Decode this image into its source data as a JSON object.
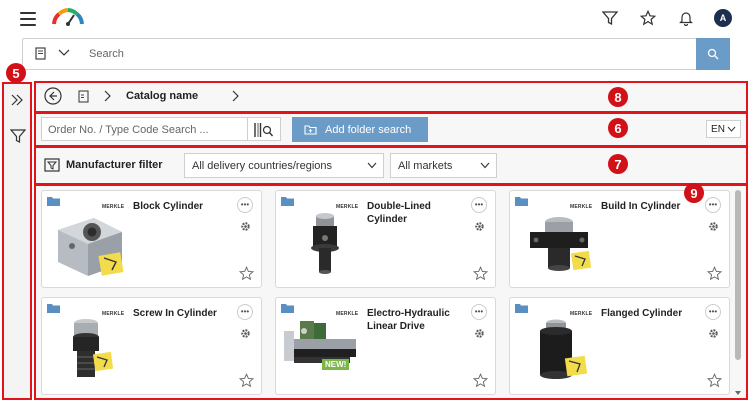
{
  "header": {
    "icons": [
      "menu-icon",
      "logo",
      "filter-icon",
      "star-icon",
      "bell-icon"
    ],
    "avatar_initial": "A"
  },
  "search": {
    "placeholder": "Search"
  },
  "breadcrumb": {
    "title": "Catalog name"
  },
  "order_search": {
    "placeholder": "Order No. / Type Code Search ...",
    "add_folder_label": "Add folder search",
    "language": "EN"
  },
  "filters": {
    "manufacturer_label": "Manufacturer filter",
    "countries_value": "All delivery countries/regions",
    "markets_value": "All markets"
  },
  "callouts": {
    "b5": "5",
    "b6": "6",
    "b7": "7",
    "b8": "8",
    "b9": "9"
  },
  "cards": [
    {
      "name": "Block Cylinder",
      "brand": "MERKLE"
    },
    {
      "name": "Double-Lined Cylinder",
      "brand": "MERKLE"
    },
    {
      "name": "Build In Cylinder",
      "brand": "MERKLE"
    },
    {
      "name": "Screw In Cylinder",
      "brand": "MERKLE"
    },
    {
      "name": "Electro-Hydraulic Linear Drive",
      "brand": "MERKLE",
      "badge": "NEW!"
    },
    {
      "name": "Flanged Cylinder",
      "brand": "MERKLE"
    }
  ],
  "colors": {
    "accent": "#6b9bc7",
    "callout_red": "#d21018",
    "folder_blue": "#5a8fc4"
  }
}
